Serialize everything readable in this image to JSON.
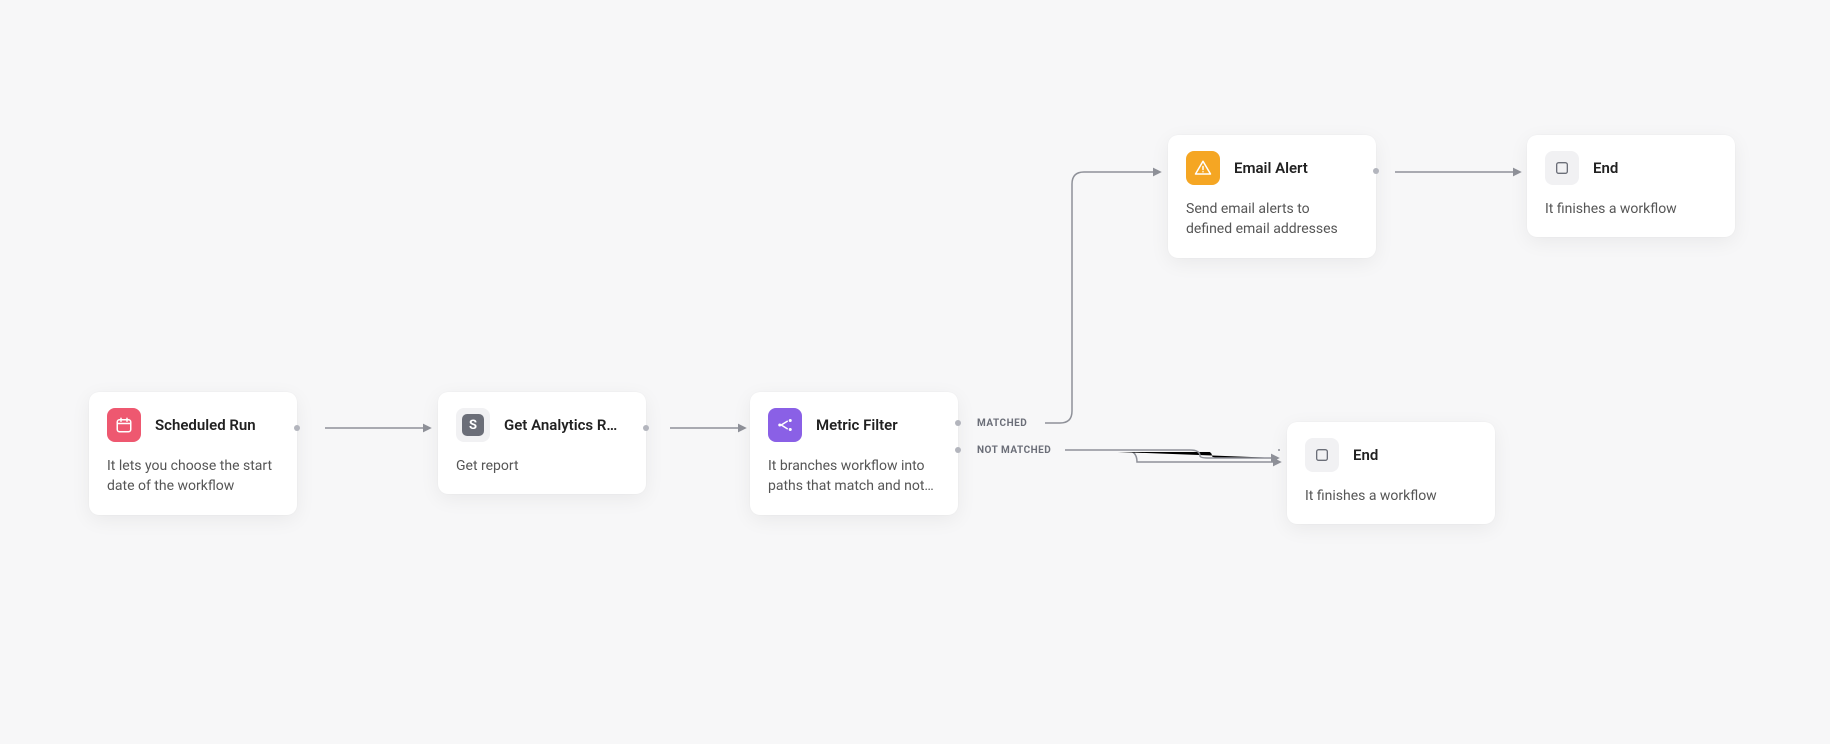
{
  "nodes": {
    "scheduled": {
      "title": "Scheduled Run",
      "desc": "It lets you choose the start date of the workflow"
    },
    "analytics": {
      "title": "Get Analytics R…",
      "desc": "Get report"
    },
    "filter": {
      "title": "Metric Filter",
      "desc": "It branches workflow into paths that match and not…"
    },
    "email": {
      "title": "Email Alert",
      "desc": "Send email alerts to defined email addresses"
    },
    "end_top": {
      "title": "End",
      "desc": "It finishes a workflow"
    },
    "end_bottom": {
      "title": "End",
      "desc": "It finishes a workflow"
    }
  },
  "branch_labels": {
    "matched": "MATCHED",
    "not_matched": "NOT MATCHED"
  },
  "colors": {
    "pink": "#ee5870",
    "purple": "#8a60e6",
    "orange": "#f5a623",
    "gray_bg": "#f1f1f3",
    "connector": "#8f9199",
    "port": "#b3b5bd"
  }
}
